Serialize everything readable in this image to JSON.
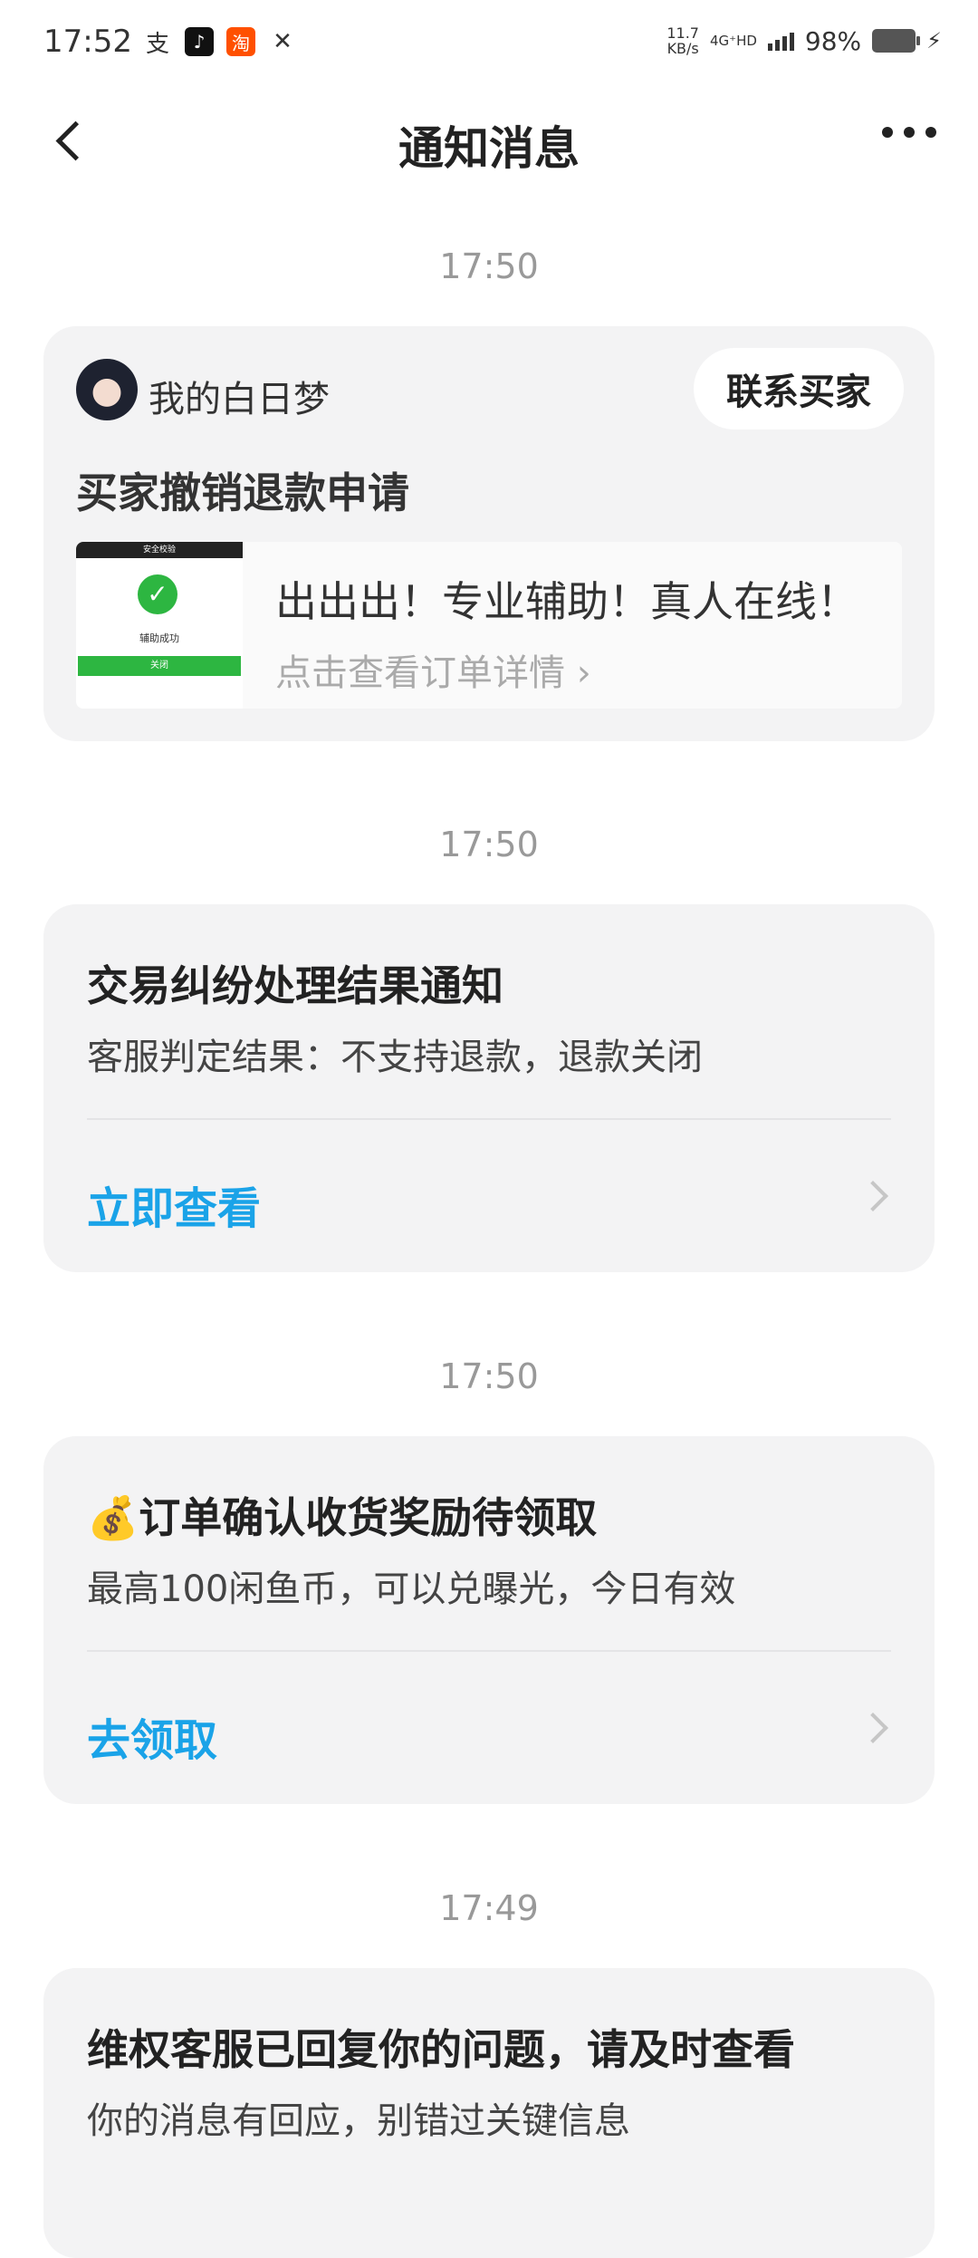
{
  "status_bar": {
    "time": "17:52",
    "speed_value": "11.7",
    "speed_unit": "KB/s",
    "network": "4G⁺HD",
    "battery": "98%",
    "icons": [
      "alipay-icon",
      "tiktok-icon",
      "taobao-icon",
      "tools-icon"
    ]
  },
  "header": {
    "title": "通知消息"
  },
  "messages": [
    {
      "time": "17:50",
      "user_name": "我的白日梦",
      "contact_label": "联系买家",
      "title": "买家撤销退款申请",
      "thumb": {
        "header": "安全校验",
        "text": "辅助成功",
        "button": "关闭"
      },
      "order_title": "出出出！专业辅助！真人在线！",
      "order_link": "点击查看订单详情"
    },
    {
      "time": "17:50",
      "title": "交易纠纷处理结果通知",
      "desc": "客服判定结果：不支持退款，退款关闭",
      "action": "立即查看"
    },
    {
      "time": "17:50",
      "title": "💰订单确认收货奖励待领取",
      "desc": "最高100闲鱼币，可以兑曝光，今日有效",
      "action": "去领取"
    },
    {
      "time": "17:49",
      "title": "维权客服已回复你的问题，请及时查看",
      "desc": "你的消息有回应，别错过关键信息"
    }
  ],
  "colors": {
    "accent": "#1aa3e8",
    "card_bg": "#f3f3f4",
    "timestamp": "#999999"
  }
}
